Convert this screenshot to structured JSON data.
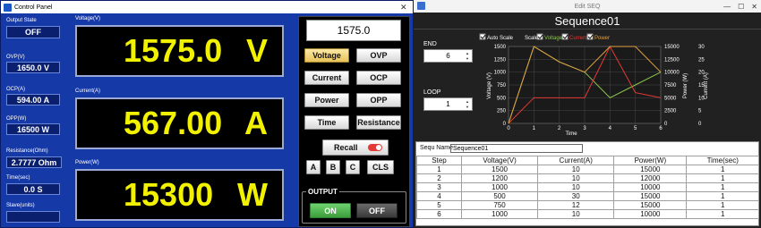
{
  "control_panel": {
    "title": "Control Panel",
    "labels": {
      "output_state": "Output State",
      "ovp": "OVP(V)",
      "ocp": "OCP(A)",
      "opp": "OPP(W)",
      "resistance": "Resistance(Ohm)",
      "time": "Time(sec)",
      "slave": "Slave(units)",
      "voltage": "Voltage(V)",
      "current": "Current(A)",
      "power": "Power(W)"
    },
    "values": {
      "output_state": "OFF",
      "ovp": "1650.0 V",
      "ocp": "594.00 A",
      "opp": "16500 W",
      "resistance": "2.7777 Ohm",
      "time": "0.0 S",
      "slave": ""
    },
    "displays": {
      "voltage_value": "1575.0",
      "voltage_unit": "V",
      "current_value": "567.00",
      "current_unit": "A",
      "power_value": "15300",
      "power_unit": "W"
    },
    "input_value": "1575.0",
    "buttons": {
      "voltage": "Voltage",
      "ovp": "OVP",
      "current": "Current",
      "ocp": "OCP",
      "power": "Power",
      "opp": "OPP",
      "time": "Time",
      "resistance": "Resistance",
      "recall": "Recall",
      "a": "A",
      "b": "B",
      "c": "C",
      "cls": "CLS",
      "on": "ON",
      "off": "OFF"
    },
    "output_label": "OUTPUT",
    "close_glyph": "✕"
  },
  "edit_seq": {
    "title": "Edit SEQ",
    "window_controls": [
      "—",
      "☐",
      "✕"
    ],
    "sequence_title": "Sequence01",
    "end_label": "END",
    "end_value": "6",
    "loop_label": "LOOP",
    "loop_value": "1",
    "checkboxes": {
      "auto_scale": "Auto Scale",
      "scale": "Scale",
      "voltage": "Voltage",
      "current": "Current",
      "power": "Power"
    },
    "seq_name_label": "Sequ Name",
    "seq_name_value": "Sequence01",
    "table": {
      "headers": [
        "Step",
        "Voltage(V)",
        "Current(A)",
        "Power(W)",
        "Time(sec)"
      ],
      "rows": [
        [
          "1",
          "1500",
          "10",
          "15000",
          "1"
        ],
        [
          "2",
          "1200",
          "10",
          "12000",
          "1"
        ],
        [
          "3",
          "1000",
          "10",
          "10000",
          "1"
        ],
        [
          "4",
          "500",
          "30",
          "15000",
          "1"
        ],
        [
          "5",
          "750",
          "12",
          "15000",
          "1"
        ],
        [
          "6",
          "1000",
          "10",
          "10000",
          "1"
        ]
      ]
    }
  },
  "chart_data": {
    "type": "line",
    "xlabel": "Time",
    "ylabel": "Voltage (V)",
    "y2label": "Power (W)",
    "y3label": "Current (A)",
    "x": [
      0,
      1,
      2,
      3,
      4,
      5,
      6
    ],
    "xlim": [
      0,
      6
    ],
    "ylim": [
      0,
      1500
    ],
    "y2lim": [
      0,
      15000
    ],
    "y3lim": [
      0,
      30
    ],
    "yticks": [
      0,
      250,
      500,
      750,
      1000,
      1250,
      1500
    ],
    "y2ticks": [
      0,
      2500,
      5000,
      7500,
      10000,
      12500,
      15000
    ],
    "y3ticks": [
      0,
      5,
      10,
      15,
      20,
      25,
      30
    ],
    "series": [
      {
        "name": "Voltage",
        "color": "#8bc34a",
        "axis": "left",
        "values": [
          0,
          1500,
          1200,
          1000,
          500,
          750,
          1000
        ]
      },
      {
        "name": "Current",
        "color": "#e53935",
        "axis": "current",
        "values": [
          0,
          10,
          10,
          10,
          30,
          12,
          10
        ]
      },
      {
        "name": "Power",
        "color": "#e0a040",
        "axis": "power",
        "values": [
          0,
          15000,
          12000,
          10000,
          15000,
          15000,
          10000
        ]
      }
    ],
    "grid": true,
    "legend": "top"
  },
  "colors": {
    "cp_bg": "#1639a8",
    "display_text": "#f2f200",
    "selected_button": "#e7c35a",
    "on_button": "#4caf50"
  }
}
